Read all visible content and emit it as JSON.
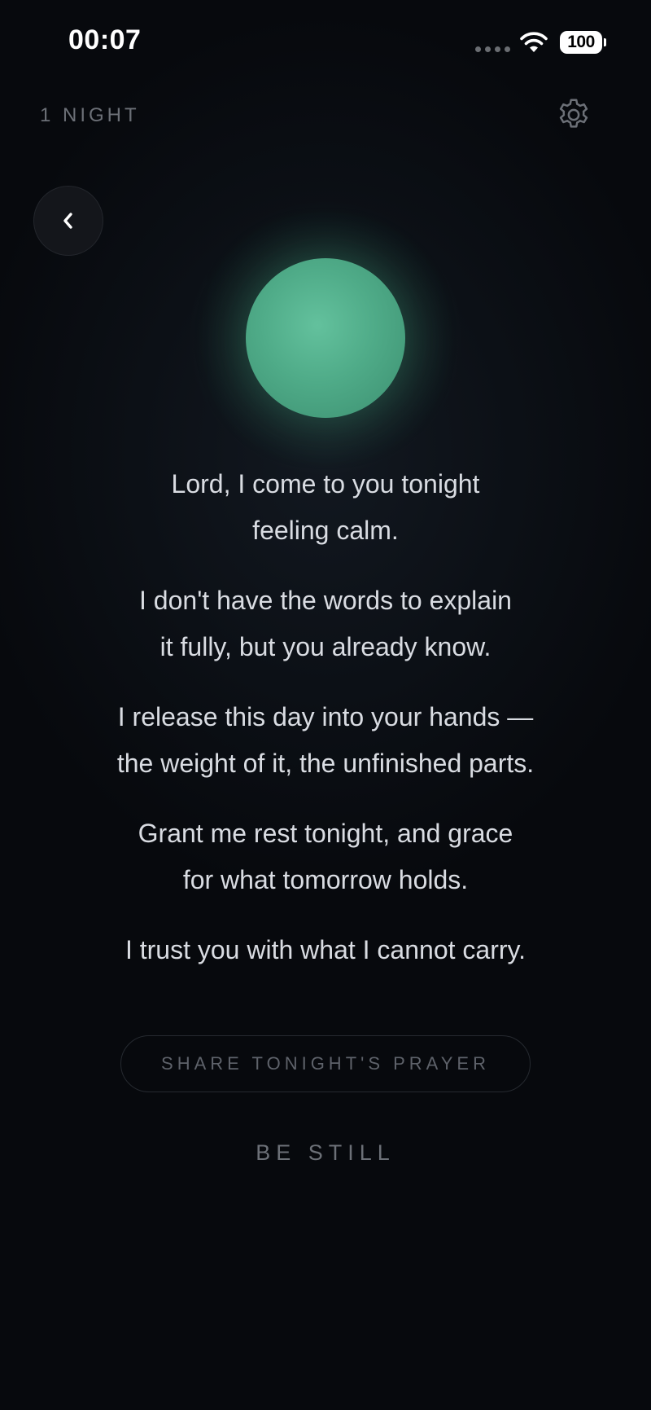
{
  "status_bar": {
    "time": "00:07",
    "battery_level": "100"
  },
  "header": {
    "night_count": "1 NIGHT"
  },
  "icons": {
    "settings": "gear-icon",
    "back": "chevron-left-icon",
    "wifi": "wifi-icon"
  },
  "colors": {
    "orb": "#52ae8b",
    "background": "#07090d",
    "text": "#d9dce2",
    "muted": "#6c7077"
  },
  "prayer": {
    "paragraphs": [
      [
        "Lord, I come to you tonight",
        "feeling calm."
      ],
      [
        "I don't have the words to explain",
        "it fully, but you already know."
      ],
      [
        "I release this day into your hands —",
        "the weight of it, the unfinished parts."
      ],
      [
        "Grant me rest tonight, and grace",
        "for what tomorrow holds."
      ],
      [
        "I trust you with what I cannot carry."
      ]
    ]
  },
  "actions": {
    "share_label": "SHARE TONIGHT'S PRAYER",
    "be_still_label": "BE STILL"
  }
}
